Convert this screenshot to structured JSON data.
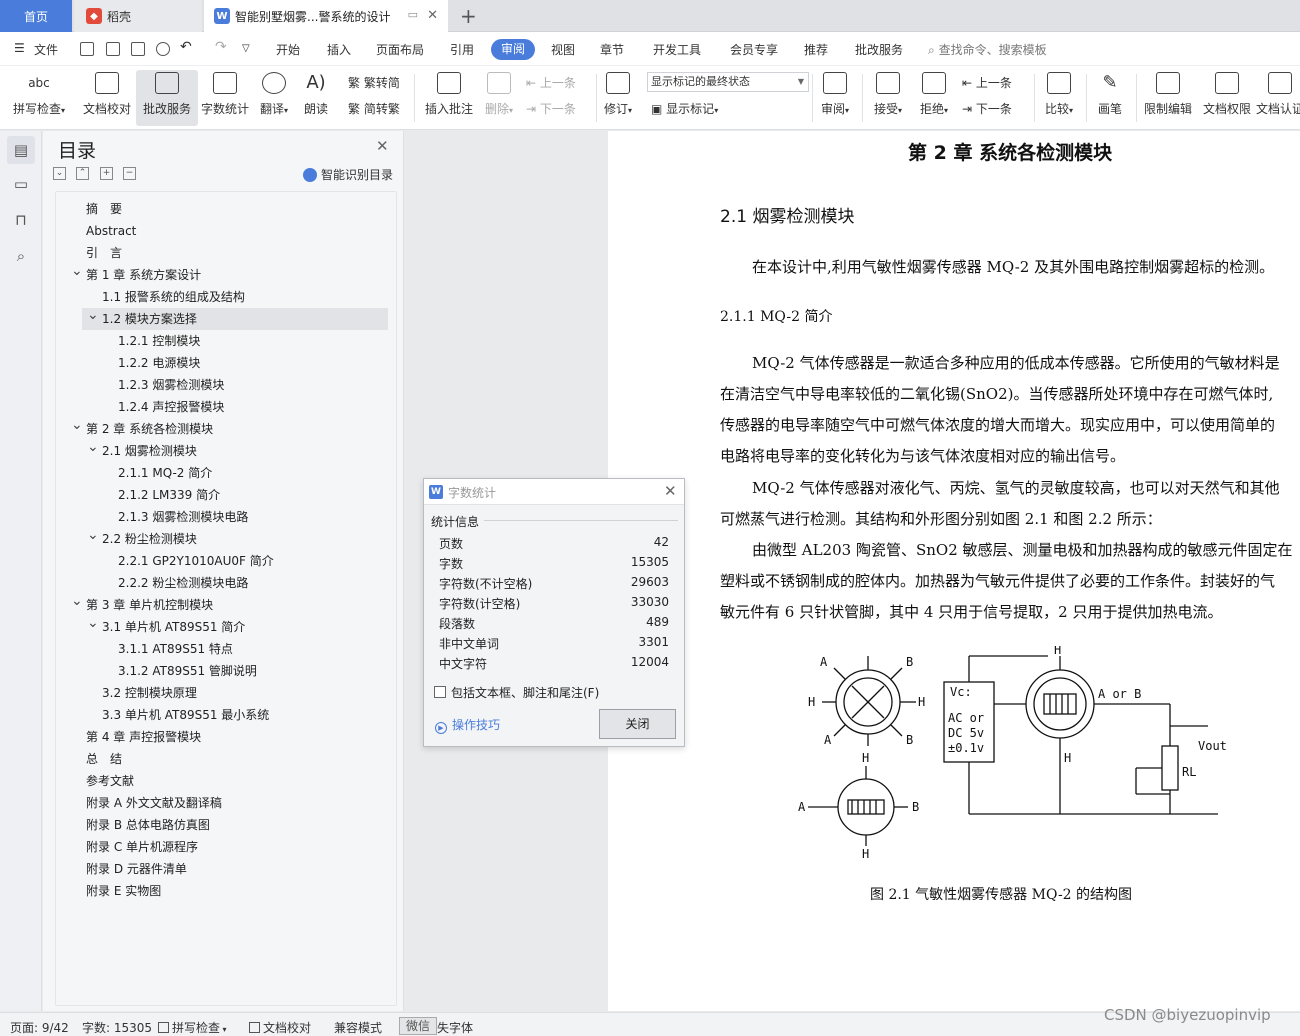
{
  "tabs": {
    "home": "首页",
    "daoke": "稻壳",
    "doc": "智能别墅烟雾...警系统的设计",
    "daoke_color": "#e24b3b",
    "doc_color": "#4a7ddb"
  },
  "menu": {
    "file": "文件",
    "items": [
      "开始",
      "插入",
      "页面布局",
      "引用",
      "审阅",
      "视图",
      "章节",
      "开发工具",
      "会员专享",
      "推荐",
      "批改服务"
    ],
    "active": "审阅",
    "search": "查找命令、搜索模板"
  },
  "ribbon": {
    "spell": "拼写检查",
    "doc_check": "文档校对",
    "correction": "批改服务",
    "word_count": "字数统计",
    "translate": "翻译",
    "read": "朗读",
    "trad": "繁转简",
    "simp": "简转繁",
    "insert_comment": "插入批注",
    "delete": "删除",
    "prev_item": "上一条",
    "next_item": "下一条",
    "revise": "修订",
    "markup_state": "显示标记的最终状态",
    "show_markup": "显示标记",
    "review": "审阅",
    "accept": "接受",
    "reject": "拒绝",
    "prev": "上一条",
    "next": "下一条",
    "compare": "比较",
    "pen": "画笔",
    "restrict": "限制编辑",
    "doc_rights": "文档权限",
    "doc_auth": "文档认证"
  },
  "toc": {
    "title": "目录",
    "smart": "智能识别目录",
    "items": [
      {
        "label": "摘　要",
        "level": 0,
        "chev": ""
      },
      {
        "label": "Abstract",
        "level": 0,
        "chev": ""
      },
      {
        "label": "引　言",
        "level": 0,
        "chev": ""
      },
      {
        "label": "第 1 章  系统方案设计",
        "level": 0,
        "chev": "v"
      },
      {
        "label": "1.1 报警系统的组成及结构",
        "level": 1,
        "chev": ""
      },
      {
        "label": "1.2 模块方案选择",
        "level": 1,
        "chev": "v",
        "selected": true
      },
      {
        "label": "1.2.1 控制模块",
        "level": 2,
        "chev": ""
      },
      {
        "label": "1.2.2 电源模块",
        "level": 2,
        "chev": ""
      },
      {
        "label": "1.2.3 烟雾检测模块",
        "level": 2,
        "chev": ""
      },
      {
        "label": "1.2.4 声控报警模块",
        "level": 2,
        "chev": ""
      },
      {
        "label": "第 2 章  系统各检测模块",
        "level": 0,
        "chev": "v"
      },
      {
        "label": "2.1 烟雾检测模块",
        "level": 1,
        "chev": "v"
      },
      {
        "label": "2.1.1 MQ-2 简介",
        "level": 2,
        "chev": ""
      },
      {
        "label": "2.1.2 LM339 简介",
        "level": 2,
        "chev": ""
      },
      {
        "label": "2.1.3 烟雾检测模块电路",
        "level": 2,
        "chev": ""
      },
      {
        "label": "2.2 粉尘检测模块",
        "level": 1,
        "chev": "v"
      },
      {
        "label": "2.2.1 GP2Y1010AU0F 简介",
        "level": 2,
        "chev": ""
      },
      {
        "label": "2.2.2 粉尘检测模块电路",
        "level": 2,
        "chev": ""
      },
      {
        "label": "第 3 章  单片机控制模块",
        "level": 0,
        "chev": "v"
      },
      {
        "label": "3.1 单片机 AT89S51 简介",
        "level": 1,
        "chev": "v"
      },
      {
        "label": "3.1.1 AT89S51 特点",
        "level": 2,
        "chev": ""
      },
      {
        "label": "3.1.2 AT89S51 管脚说明",
        "level": 2,
        "chev": ""
      },
      {
        "label": "3.2 控制模块原理",
        "level": 1,
        "chev": ""
      },
      {
        "label": "3.3 单片机 AT89S51 最小系统",
        "level": 1,
        "chev": ""
      },
      {
        "label": "第 4 章  声控报警模块",
        "level": 0,
        "chev": ""
      },
      {
        "label": "总　结",
        "level": 0,
        "chev": ""
      },
      {
        "label": "参考文献",
        "level": 0,
        "chev": ""
      },
      {
        "label": "附录 A  外文文献及翻译稿",
        "level": 0,
        "chev": ""
      },
      {
        "label": "附录 B  总体电路仿真图",
        "level": 0,
        "chev": ""
      },
      {
        "label": "附录 C  单片机源程序",
        "level": 0,
        "chev": ""
      },
      {
        "label": "附录 D  元器件清单",
        "level": 0,
        "chev": ""
      },
      {
        "label": "附录 E  实物图",
        "level": 0,
        "chev": ""
      }
    ]
  },
  "doc": {
    "chapter": "第 2 章  系统各检测模块",
    "section": "2.1 烟雾检测模块",
    "intro": "在本设计中,利用气敏性烟雾传感器 MQ-2 及其外围电路控制烟雾超标的检测。",
    "subsection": "2.1.1 MQ-2 简介",
    "paragraph_lines": [
      "MQ-2 气体传感器是一款适合多种应用的低成本传感器。它所使用的气敏材料是",
      "在清洁空气中导电率较低的二氧化锡(SnO2)。当传感器所处环境中存在可燃气体时,",
      "传感器的电导率随空气中可燃气体浓度的增大而增大。现实应用中，可以使用简单的",
      "电路将电导率的变化转化为与该气体浓度相对应的输出信号。",
      "MQ-2 气体传感器对液化气、丙烷、氢气的灵敏度较高，也可以对天然气和其他",
      "可燃蒸气进行检测。其结构和外形图分别如图 2.1 和图 2.2 所示：",
      "由微型 AL203 陶瓷管、SnO2 敏感层、测量电极和加热器构成的敏感元件固定在",
      "塑料或不锈钢制成的腔体内。加热器为气敏元件提供了必要的工作条件。封装好的气",
      "敏元件有 6 只针状管脚，其中 4 只用于信号提取，2 只用于提供加热电流。"
    ],
    "figure_caption": "图 2.1  气敏性烟雾传感器 MQ-2 的结构图",
    "figure_labels": {
      "a": "A",
      "b": "B",
      "h": "H",
      "vc1": "Vc:",
      "vc2": "AC or",
      "vc3": "DC 5v",
      "vc4": "±0.1v",
      "a_or_b": "A or B",
      "vout": "Vout",
      "rl": "RL"
    }
  },
  "dialog": {
    "title": "字数统计",
    "section": "统计信息",
    "stats": [
      {
        "label": "页数",
        "value": "42"
      },
      {
        "label": "字数",
        "value": "15305"
      },
      {
        "label": "字符数(不计空格)",
        "value": "29603"
      },
      {
        "label": "字符数(计空格)",
        "value": "33030"
      },
      {
        "label": "段落数",
        "value": "489"
      },
      {
        "label": "非中文单词",
        "value": "3301"
      },
      {
        "label": "中文字符",
        "value": "12004"
      }
    ],
    "include_label": "包括文本框、脚注和尾注(F)",
    "tips": "操作技巧",
    "close": "关闭"
  },
  "status": {
    "page": "页面: 9/42",
    "words": "字数: 15305",
    "spell": "拼写检查",
    "doc_check": "文档校对",
    "compat": "兼容模式",
    "wechat": "微信",
    "missing_font": "失字体",
    "watermark": "CSDN @biyezuopinvip"
  }
}
